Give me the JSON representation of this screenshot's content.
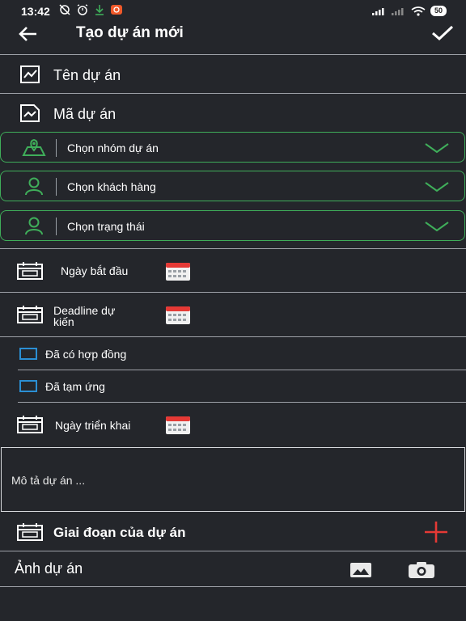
{
  "status_bar": {
    "time": "13:42",
    "battery": "50"
  },
  "header": {
    "title": "Tạo dự án mới"
  },
  "fields": {
    "project_name": "Tên dự án",
    "project_code": "Mã dự án"
  },
  "selects": {
    "group": "Chọn nhóm dự án",
    "customer": "Chọn khách hàng",
    "status": "Chọn trạng thái"
  },
  "dates": {
    "start": "Ngày bắt đầu",
    "deadline_line1": "Deadline dự",
    "deadline_line2": "kiến",
    "deploy": "Ngày triển khai"
  },
  "checkboxes": {
    "contract": "Đã có hợp đồng",
    "advance": "Đã tạm ứng"
  },
  "description": {
    "placeholder": "Mô tả dự án ..."
  },
  "phases": {
    "label": "Giai đoạn của dự án"
  },
  "images": {
    "label": "Ảnh dự án"
  },
  "colors": {
    "accent_green": "#3fae5a",
    "checkbox_blue": "#2b8fd4",
    "add_red": "#e53935",
    "background": "#24262b"
  }
}
